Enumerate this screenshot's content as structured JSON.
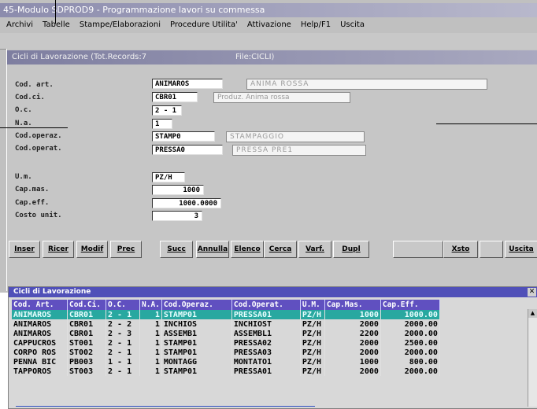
{
  "app": {
    "title": "45-Modulo SDPROD9 - Programmazione lavori su commessa",
    "menu": [
      "Archivi",
      "Tabelle",
      "Stampe/Elaborazioni",
      "Procedure Utilita'",
      "Attivazione",
      "Help/F1",
      "Uscita"
    ]
  },
  "form": {
    "title": "Cicli di Lavorazione (Tot.Records:7",
    "file": "File:CICLI)",
    "fields": [
      {
        "label": "Cod. art.",
        "value": "ANIMAROS",
        "desc": "ANIMA ROSSA"
      },
      {
        "label": "Cod.ci.",
        "value": "CBR01",
        "desc": "Produz. Anima rossa"
      },
      {
        "label": "O.c.",
        "value": "2 - 1"
      },
      {
        "label": "N.a.",
        "value": "1"
      },
      {
        "label": "Cod.operaz.",
        "value": "STAMP0",
        "desc": "STAMPAGGIO"
      },
      {
        "label": "Cod.operat.",
        "value": "PRESSA0",
        "desc": "PRESSA PRE1"
      },
      {
        "label": "U.m.",
        "value": "PZ/H"
      },
      {
        "label": "Cap.mas.",
        "value": "1000"
      },
      {
        "label": "Cap.eff.",
        "value": "1000.0000"
      },
      {
        "label": "Costo unit.",
        "value": "3"
      }
    ],
    "buttons": [
      "Inser",
      "Ricer",
      "Modif",
      "Prec",
      "Succ",
      "Annulla",
      "Elenco",
      "Cerca",
      "Varf.",
      "Dupl",
      "",
      "Xsto",
      "",
      "Uscita"
    ]
  },
  "grid": {
    "title": "Cicli di Lavorazione",
    "columns": [
      "Cod. Art.",
      "Cod.Ci.",
      "O.C.",
      "N.A.",
      "Cod.Operaz.",
      "Cod.Operat.",
      "U.M.",
      "Cap.Mas.",
      "Cap.Eff."
    ],
    "rows": [
      [
        "ANIMAROS",
        "CBR01",
        "2 - 1",
        "1",
        "STAMP01",
        "PRESSA01",
        "PZ/H",
        "1000",
        "1000.00"
      ],
      [
        "ANIMAROS",
        "CBR01",
        "2 - 2",
        "1",
        "INCHIOS",
        "INCHIOST",
        "PZ/H",
        "2000",
        "2000.00"
      ],
      [
        "ANIMAROS",
        "CBR01",
        "2 - 3",
        "1",
        "ASSEMB1",
        "ASSEMBL1",
        "PZ/H",
        "2200",
        "2000.00"
      ],
      [
        "CAPPUCROS",
        "ST001",
        "2 - 1",
        "1",
        "STAMP01",
        "PRESSA02",
        "PZ/H",
        "2000",
        "2500.00"
      ],
      [
        "CORPO ROS",
        "ST002",
        "2 - 1",
        "1",
        "STAMP01",
        "PRESSA03",
        "PZ/H",
        "2000",
        "2000.00"
      ],
      [
        "PENNA BIC",
        "PB003",
        "1 - 1",
        "1",
        "MONTAGG",
        "MONTATO1",
        "PZ/H",
        "1000",
        "800.00"
      ],
      [
        "TAPPOROS",
        "ST003",
        "2 - 1",
        "1",
        "STAMP01",
        "PRESSA01",
        "PZ/H",
        "2000",
        "2000.00"
      ]
    ],
    "selected_row": 0,
    "selection_color": "#28a8a0"
  }
}
